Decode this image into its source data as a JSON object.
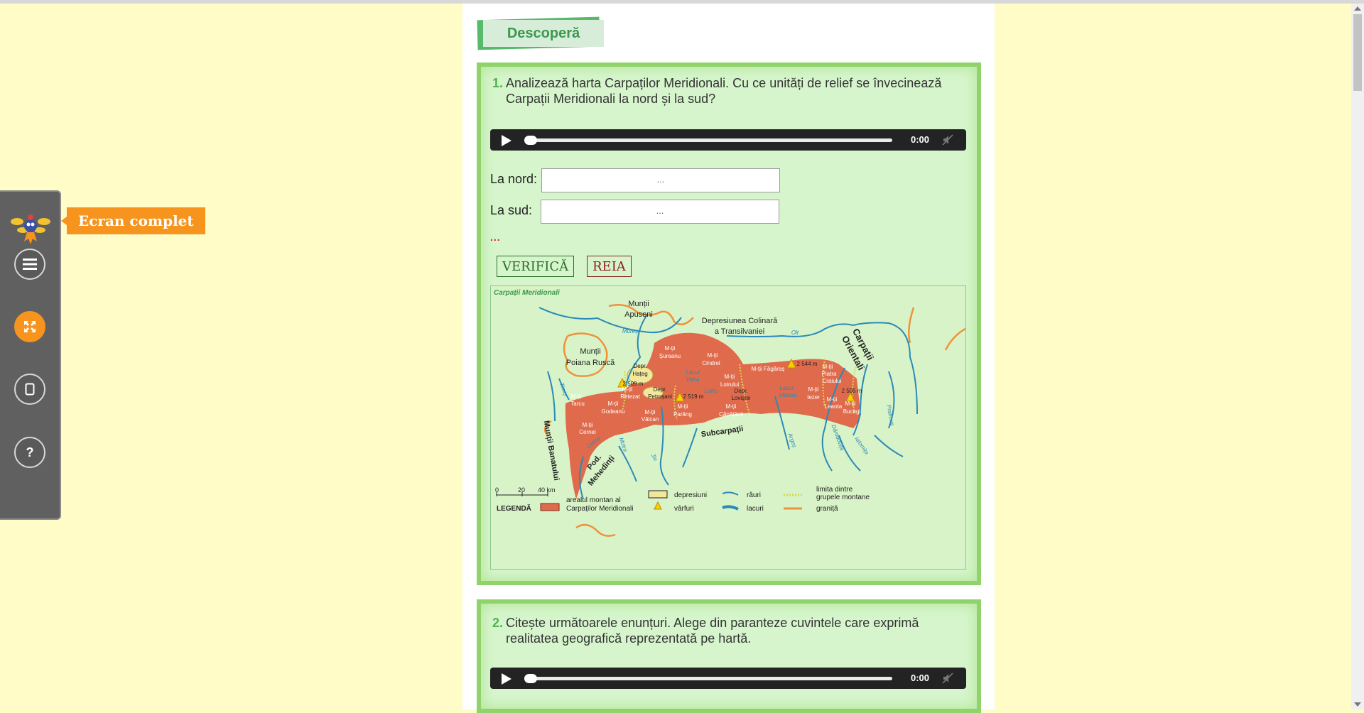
{
  "tooltip": "Ecran complet",
  "toolbar": {
    "buttons": [
      {
        "name": "menu",
        "icon": "menu-icon"
      },
      {
        "name": "fullscreen",
        "icon": "expand-icon",
        "active": true
      },
      {
        "name": "page",
        "icon": "page-icon"
      },
      {
        "name": "help",
        "icon": "help-icon",
        "glyph": "?"
      }
    ]
  },
  "section_title": "Descoperă",
  "q1": {
    "number": "1.",
    "text": "Analizează harta Carpaților Meridionali. Cu ce unități de relief se învecinează Carpații Meridionali la nord și la sud?",
    "audio_time": "0:00",
    "north_label": "La nord:",
    "north_value": "...",
    "south_label": "La sud:",
    "south_value": "...",
    "dots": "...",
    "verify_label": "VERIFICĂ",
    "reset_label": "REIA"
  },
  "map": {
    "title": "Carpații Meridionali",
    "labels": {
      "apuseni1": "Munții",
      "apuseni2": "Apuseni",
      "transilv1": "Depresiunea Colinară",
      "transilv2": "a Transilvaniei",
      "poiana1": "Munții",
      "poiana2": "Poiana Ruscă",
      "orientali1": "Carpații",
      "orientali2": "Orientali",
      "banat": "Munții Banatului",
      "mehedinti1": "Pod.",
      "mehedinti2": "Mehedinți",
      "subcarpati": "Subcarpații",
      "sureanu1": "M-ții",
      "sureanu2": "Șureanu",
      "cindrel1": "M-ții",
      "cindrel2": "Cindrel",
      "hateg1": "Depr.",
      "hateg2": "Hațeg",
      "tarcu1": "M-ții",
      "tarcu2": "Tarcu",
      "retezat1": "M-ții",
      "retezat2": "Retezat",
      "godeanu1": "M-ții",
      "godeanu2": "Godeanu",
      "cernei1": "M-ții",
      "cernei2": "Cernei",
      "valcan1": "M-ții",
      "valcan2": "Vâlcan",
      "parang1": "M-ții",
      "parang2": "Parâng",
      "lotrului1": "M-ții",
      "lotrului2": "Lotrului",
      "capatanii1": "M-ții",
      "capatanii2": "Căpățânii",
      "fagaras": "M-ții Făgăraș",
      "iezer1": "M-ții",
      "iezer2": "Iezer",
      "piatra1": "M-ții",
      "piatra2": "Piatra",
      "piatra3": "Craiului",
      "leaota1": "M-ții",
      "leaota2": "Leaota",
      "bucegi1": "M-ții",
      "bucegi2": "Bucegi",
      "lotru": "Lotru",
      "depr_lovistei1": "Depr.",
      "depr_lovistei2": "Loviștei",
      "petrosani1": "Depr.",
      "petrosani2": "Petroșani",
      "lacul_vidra1": "Lacul",
      "lacul_vidra2": "Vidra",
      "lacul_vidraru1": "Lacul",
      "lacul_vidraru2": "Vidraru",
      "peak1": "2 509 m",
      "peak2": "2 519 m",
      "peak3": "2 544 m",
      "peak4": "2 505 m",
      "mures": "Mureș",
      "olt": "Olt",
      "timis": "Timiș",
      "cerna": "Cerna",
      "motru": "Motru",
      "jiu": "Jiu",
      "arges": "Argeș",
      "dambovita": "Dâmbovița",
      "ialomita": "Ialomița",
      "prahova": "Prahova"
    },
    "scale": {
      "t0": "0",
      "t1": "20",
      "t2": "40 km"
    },
    "legend": {
      "title": "LEGENDĂ",
      "montan1": "arealul montan al",
      "montan2": "Carpaților Meridionali",
      "depresiuni": "depresiuni",
      "varfuri": "vârfuri",
      "rauri": "râuri",
      "lacuri": "lacuri",
      "limita1": "limita dintre",
      "limita2": "grupele montane",
      "granita": "graniță"
    },
    "colors": {
      "mountain": "#e06a4c",
      "river": "#2a8ab8",
      "border": "#f0923a",
      "depression": "#f2e79a",
      "peak": "#f8d000",
      "limit": "#d8d84a"
    }
  },
  "q2": {
    "number": "2.",
    "text": "Citește următoarele enunțuri. Alege din paranteze cuvintele care exprimă realitatea geografică reprezentată pe hartă.",
    "audio_time": "0:00"
  }
}
